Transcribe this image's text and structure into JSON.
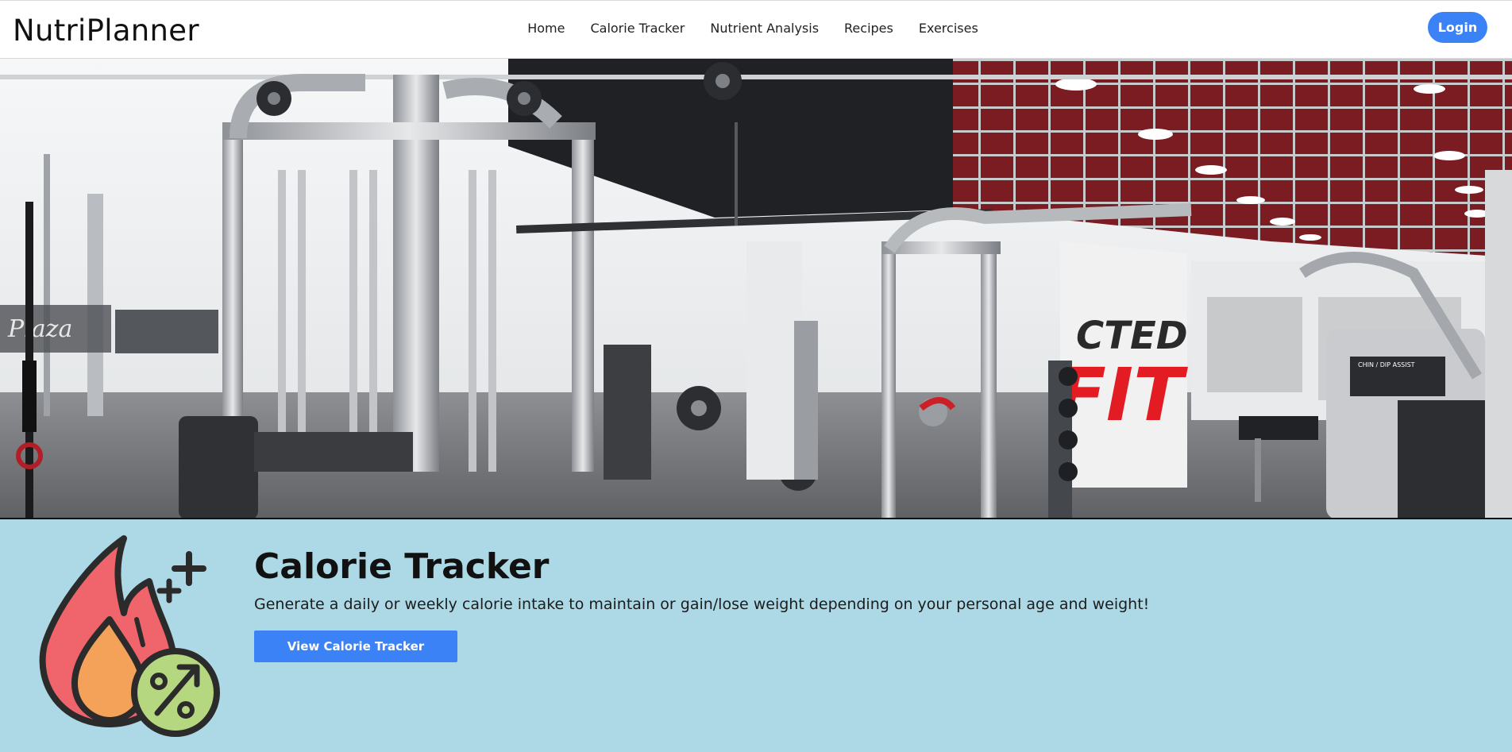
{
  "brand": {
    "title": "NutriPlanner"
  },
  "nav": {
    "items": [
      {
        "label": "Home"
      },
      {
        "label": "Calorie Tracker"
      },
      {
        "label": "Nutrient Analysis"
      },
      {
        "label": "Recipes"
      },
      {
        "label": "Exercises"
      }
    ],
    "login_label": "Login"
  },
  "hero": {
    "image_subject": "gym interior with cable machines and weight racks",
    "wall_text": "CTED FIT"
  },
  "feature": {
    "icon": "calorie-flame-icon",
    "title": "Calorie Tracker",
    "description": "Generate a daily or weekly calorie intake to maintain or gain/lose weight depending on your personal age and weight!",
    "button_label": "View Calorie Tracker"
  },
  "colors": {
    "accent": "#3b82f6",
    "feature_background": "#add8e6",
    "flame_red": "#f0646c",
    "flame_orange": "#f4a259",
    "badge_green": "#b5d77f"
  }
}
